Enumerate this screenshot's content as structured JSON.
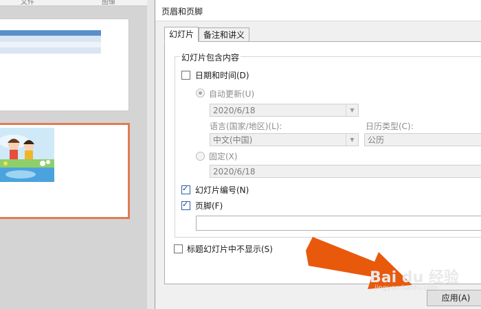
{
  "dialog": {
    "title": "页眉和页脚",
    "tabs": [
      {
        "label": "幻灯片",
        "active": true
      },
      {
        "label": "备注和讲义",
        "active": false
      }
    ],
    "group_title": "幻灯片包含内容",
    "date_time": {
      "label": "日期和时间(D)",
      "checked": false
    },
    "auto_update": {
      "label": "自动更新(U)",
      "selected": true,
      "value": "2020/6/18"
    },
    "language": {
      "label": "语言(国家/地区)(L):",
      "value": "中文(中国)"
    },
    "calendar": {
      "label": "日历类型(C):",
      "value": "公历"
    },
    "fixed": {
      "label": "固定(X)",
      "selected": false,
      "value": "2020/6/18"
    },
    "slide_number": {
      "label": "幻灯片编号(N)",
      "checked": true
    },
    "footer": {
      "label": "页脚(F)",
      "checked": true,
      "value": ""
    },
    "hide_on_title": {
      "label": "标题幻灯片中不显示(S)",
      "checked": false
    },
    "apply_button": "应用(A)"
  },
  "thumbnails": {
    "top_labels": [
      "文件",
      "图像"
    ]
  },
  "watermark": {
    "brand": "Bai du 经验",
    "url": "jingyan.baidu.com"
  },
  "colors": {
    "accent_arrow": "#e8590c",
    "selected_slide_border": "#e07b53"
  }
}
